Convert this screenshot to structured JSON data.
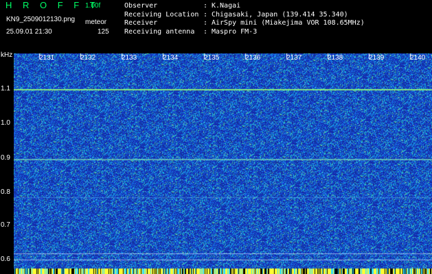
{
  "header": {
    "app_name": "H R O F F T",
    "version": "1.00f",
    "filename": "KN9_2509012130.png",
    "mode": "meteor",
    "datetime": "25.09.01 21:30",
    "count": "125"
  },
  "info": [
    {
      "key": "Observer",
      "value": "K.Nagai"
    },
    {
      "key": "Receiving Location",
      "value": "Chigasaki, Japan (139.414 35.340)"
    },
    {
      "key": "Receiver",
      "value": "AirSpy mini (Miakejima VOR 108.65MHz)"
    },
    {
      "key": "Receiving antenna",
      "value": "Maspro FM-3"
    }
  ],
  "axis": {
    "y_unit": "kHz",
    "y_ticks": [
      "1.1",
      "1.0",
      "0.9",
      "0.8",
      "0.7",
      "0.6"
    ],
    "x_ticks": [
      "2131",
      "2132",
      "2133",
      "2134",
      "2135",
      "2136",
      "2137",
      "2138",
      "2139",
      "2140"
    ]
  },
  "colors": {
    "background": "#000000",
    "waterfall_base": "#1a2fc8",
    "signal_line": "#7fff7f",
    "header_green": "#00ff66"
  }
}
